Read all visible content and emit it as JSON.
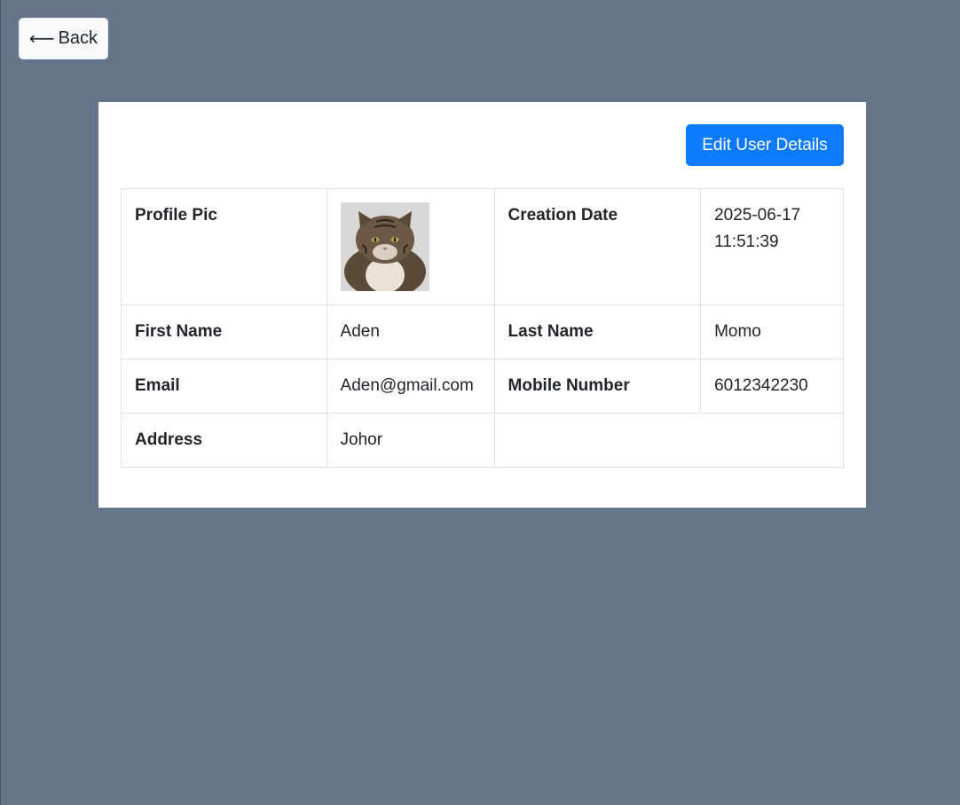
{
  "nav": {
    "back_label": "Back",
    "back_icon": "left-arrow-icon"
  },
  "actions": {
    "edit_label": "Edit User Details"
  },
  "colors": {
    "page_background": "#667489",
    "primary": "#0d7bff",
    "card_background": "#ffffff"
  },
  "details": {
    "profile_pic_label": "Profile Pic",
    "profile_pic_image": "cat-photo",
    "creation_date_label": "Creation Date",
    "creation_date_value": "2025-06-17 11:51:39",
    "first_name_label": "First Name",
    "first_name_value": "Aden",
    "last_name_label": "Last Name",
    "last_name_value": "Momo",
    "email_label": "Email",
    "email_value": "Aden@gmail.com",
    "mobile_label": "Mobile Number",
    "mobile_value": "6012342230",
    "address_label": "Address",
    "address_value": "Johor"
  }
}
